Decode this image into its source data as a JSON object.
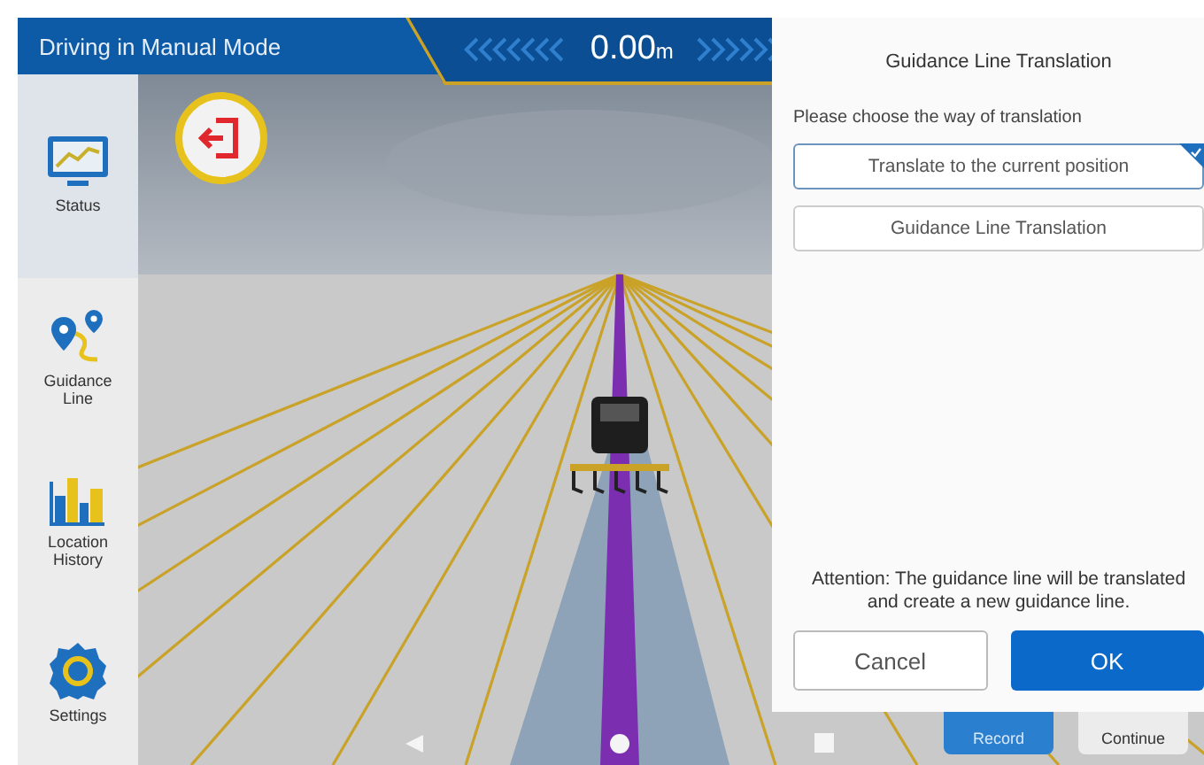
{
  "header": {
    "title": "Driving in Manual Mode",
    "offset": {
      "value": "0.00",
      "unit": "m"
    }
  },
  "sidebar": {
    "items": [
      {
        "label": "Status",
        "kind": "status",
        "selected": true
      },
      {
        "label": "Guidance Line",
        "kind": "guidance",
        "selected": false
      },
      {
        "label": "Location History",
        "kind": "history",
        "selected": false
      },
      {
        "label": "Settings",
        "kind": "settings",
        "selected": false
      }
    ]
  },
  "bottom_buttons": [
    {
      "label": "Record",
      "kind": "primary"
    },
    {
      "label": "Continue",
      "kind": "secondary"
    }
  ],
  "dialog": {
    "title": "Guidance Line Translation",
    "prompt": "Please choose the way of translation",
    "options": [
      {
        "label": "Translate to the current position",
        "selected": true
      },
      {
        "label": "Guidance Line Translation",
        "selected": false
      }
    ],
    "attention": "Attention: The guidance line will be translated and create a new guidance line.",
    "buttons": [
      {
        "label": "Cancel",
        "kind": "secondary"
      },
      {
        "label": "OK",
        "kind": "primary"
      }
    ]
  }
}
